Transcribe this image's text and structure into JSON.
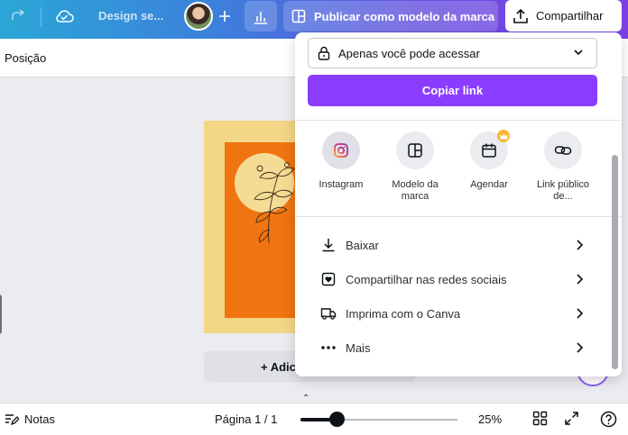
{
  "topbar": {
    "design_name": "Design se...",
    "publish_label": "Publicar como modelo da marca",
    "share_label": "Compartilhar"
  },
  "toolbar": {
    "position_label": "Posição"
  },
  "canvas": {
    "add_page_label": "+ Adici",
    "design_colors": {
      "border": "#f3d686",
      "page": "#f07410",
      "sun": "#f4dc94"
    }
  },
  "share_panel": {
    "access_value": "Apenas você pode acessar",
    "copy_link_label": "Copiar link",
    "options": [
      {
        "label": "Instagram",
        "icon": "instagram-icon"
      },
      {
        "label": "Modelo da marca",
        "icon": "template-icon"
      },
      {
        "label": "Agendar",
        "icon": "calendar-icon"
      },
      {
        "label": "Link público de...",
        "icon": "link-icon"
      }
    ],
    "rows": [
      {
        "label": "Baixar",
        "icon": "download-icon"
      },
      {
        "label": "Compartilhar nas redes sociais",
        "icon": "heart-icon"
      },
      {
        "label": "Imprima com o Canva",
        "icon": "truck-icon"
      },
      {
        "label": "Mais",
        "icon": "more-icon"
      }
    ]
  },
  "bottombar": {
    "notes_label": "Notas",
    "page_indicator": "Página 1 / 1",
    "zoom_label": "25%",
    "zoom_fraction": 0.23
  },
  "colors": {
    "accent": "#8b3dff",
    "text": "#0d1216"
  }
}
